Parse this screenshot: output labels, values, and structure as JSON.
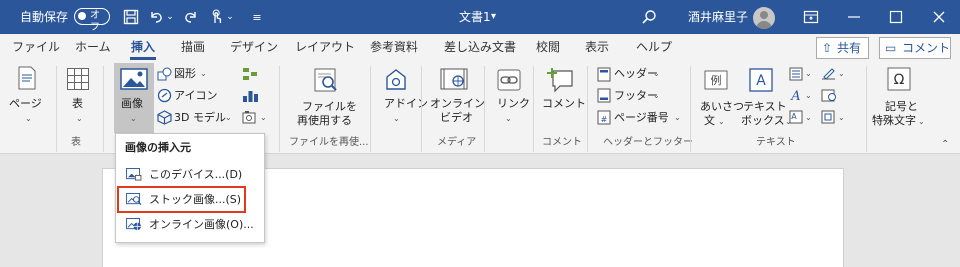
{
  "titlebar": {
    "autosave_label": "自動保存",
    "autosave_state": "オフ",
    "document_title": "文書1",
    "title_chevron": "▾",
    "user_name": "酒井麻里子"
  },
  "tabs": [
    "ファイル",
    "ホーム",
    "挿入",
    "描画",
    "デザイン",
    "レイアウト",
    "参考資料",
    "差し込み文書",
    "校閲",
    "表示",
    "ヘルプ"
  ],
  "active_tab": "挿入",
  "header_buttons": {
    "share": "共有",
    "comments": "コメント"
  },
  "ribbon": {
    "page": {
      "label": "ページ"
    },
    "table": {
      "label": "表",
      "group": "表"
    },
    "image": {
      "label": "画像"
    },
    "shapes": {
      "label": "図形"
    },
    "icons": {
      "label": "アイコン"
    },
    "models": {
      "label": "3D モデル"
    },
    "reuse": {
      "line1": "ファイルを",
      "line2": "再使用する",
      "group": "ファイルを再使..."
    },
    "addin": {
      "label": "アドイン"
    },
    "video": {
      "line1": "オンライン",
      "line2": "ビデオ",
      "group": "メディア"
    },
    "link": {
      "label": "リンク"
    },
    "comment": {
      "label": "コメント",
      "group": "コメント"
    },
    "header": {
      "label": "ヘッダー"
    },
    "footer": {
      "label": "フッター"
    },
    "pagenum": {
      "label": "ページ番号",
      "group": "ヘッダーとフッター"
    },
    "greeting": {
      "line1": "あいさつ",
      "line2": "文"
    },
    "textbox": {
      "line1": "テキスト",
      "line2": "ボックス",
      "group": "テキスト"
    },
    "symbols": {
      "line1": "記号と",
      "line2": "特殊文字"
    }
  },
  "menu": {
    "header": "画像の挿入元",
    "items": [
      {
        "label": "このデバイス...(D)"
      },
      {
        "label": "ストック画像...(S)",
        "highlighted": true
      },
      {
        "label": "オンライン画像(O)..."
      }
    ]
  },
  "colors": {
    "accent": "#2b579a",
    "highlight_box": "#e03a1e"
  }
}
